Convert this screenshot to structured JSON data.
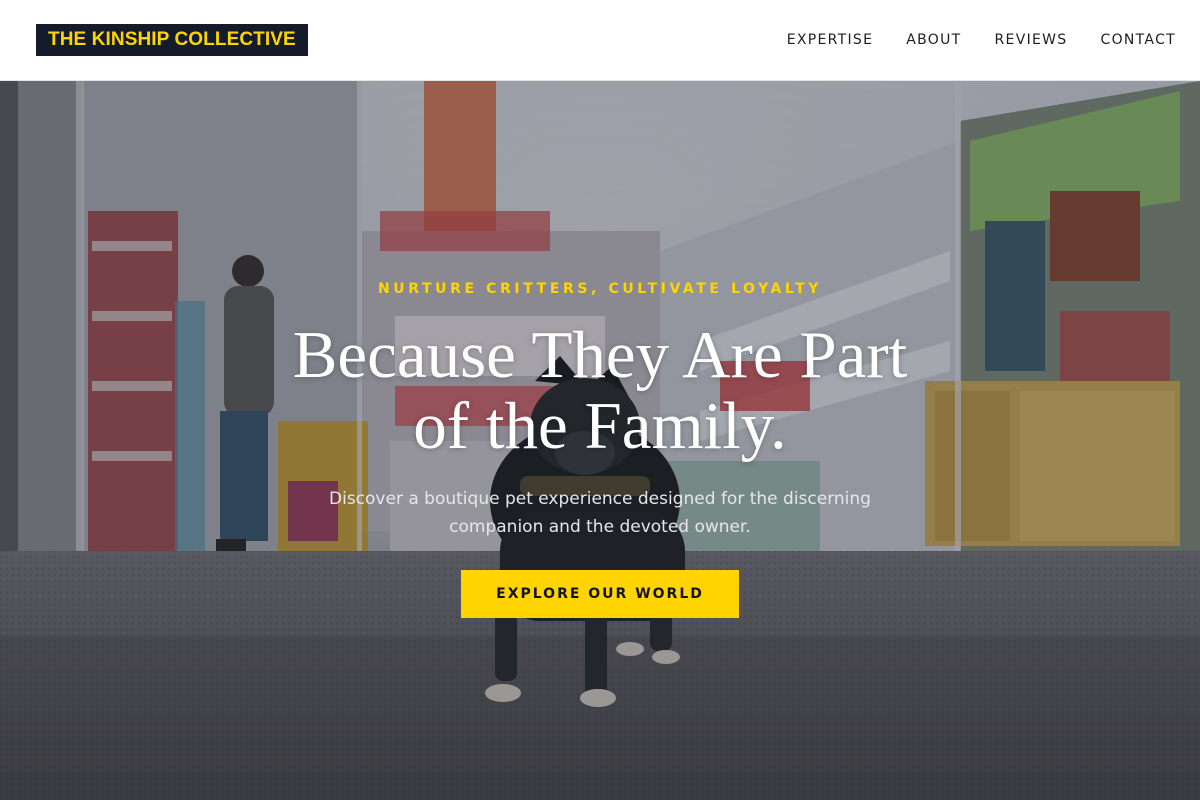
{
  "brand": {
    "name": "THE KINSHIP COLLECTIVE",
    "accent": "#ffd400",
    "dark": "#141c2c"
  },
  "nav": {
    "items": [
      {
        "label": "EXPERTISE"
      },
      {
        "label": "ABOUT"
      },
      {
        "label": "REVIEWS"
      },
      {
        "label": "CONTACT"
      }
    ]
  },
  "hero": {
    "eyebrow": "NURTURE CRITTERS, CULTIVATE LOYALTY",
    "headline": "Because They Are Part of the Family.",
    "subtitle": "Discover a boutique pet experience designed for the discerning companion and the devoted owner.",
    "cta_label": "EXPLORE OUR WORLD",
    "background": "pet-store-french-bulldog-photo"
  }
}
